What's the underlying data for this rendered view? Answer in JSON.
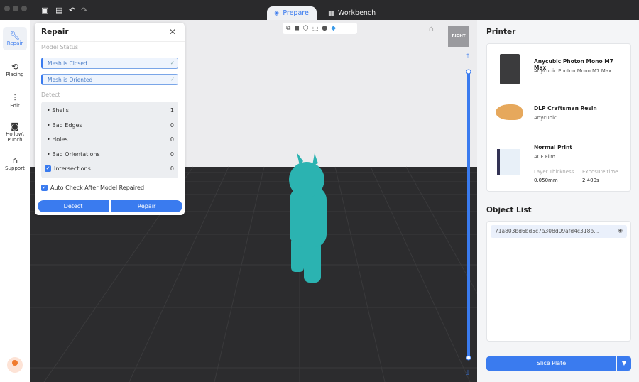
{
  "toolbar": {
    "tabs": [
      {
        "label": "Prepare",
        "icon": "layers-icon",
        "active": true
      },
      {
        "label": "Workbench",
        "icon": "grid-icon"
      }
    ]
  },
  "sidebar": {
    "items": [
      {
        "label": "Repair",
        "icon": "wrench-icon"
      },
      {
        "label": "Placing",
        "icon": "rotate-icon"
      },
      {
        "label": "Edit",
        "icon": "sliders-icon"
      },
      {
        "label": "Hollow\\ Punch",
        "icon": "hollow-icon"
      },
      {
        "label": "Support",
        "icon": "support-icon"
      }
    ]
  },
  "repair": {
    "title": "Repair",
    "model_status_label": "Model Status",
    "statuses": [
      "Mesh is Closed",
      "Mesh is Oriented"
    ],
    "detect_label": "Detect",
    "rows": [
      {
        "label": "Shells",
        "value": "1"
      },
      {
        "label": "Bad Edges",
        "value": "0"
      },
      {
        "label": "Holes",
        "value": "0"
      },
      {
        "label": "Bad Orientations",
        "value": "0"
      },
      {
        "label": "Intersections",
        "value": "0"
      }
    ],
    "auto_check": "Auto Check After Model Repaired",
    "detect_btn": "Detect",
    "repair_btn": "Repair"
  },
  "viewcube": {
    "face": "RIGHT"
  },
  "printer": {
    "heading": "Printer",
    "machine": {
      "name": "Anycubic Photon Mono M7 Max",
      "sub": "Anycubic Photon Mono M7 Max"
    },
    "resin": {
      "name": "DLP Craftsman Resin",
      "sub": "Anycubic"
    },
    "profile": {
      "name": "Normal Print",
      "sub": "ACF Film",
      "layer_label": "Layer Thickness",
      "layer_value": "0.050mm",
      "exposure_label": "Exposure time",
      "exposure_value": "2.400s"
    }
  },
  "objects": {
    "heading": "Object List",
    "items": [
      "71a803bd6bd5c7a308d09afd4c318b..."
    ]
  },
  "slice": {
    "label": "Slice Plate"
  },
  "colors": {
    "accent": "#3a7bef",
    "model": "#2bb3b1"
  }
}
